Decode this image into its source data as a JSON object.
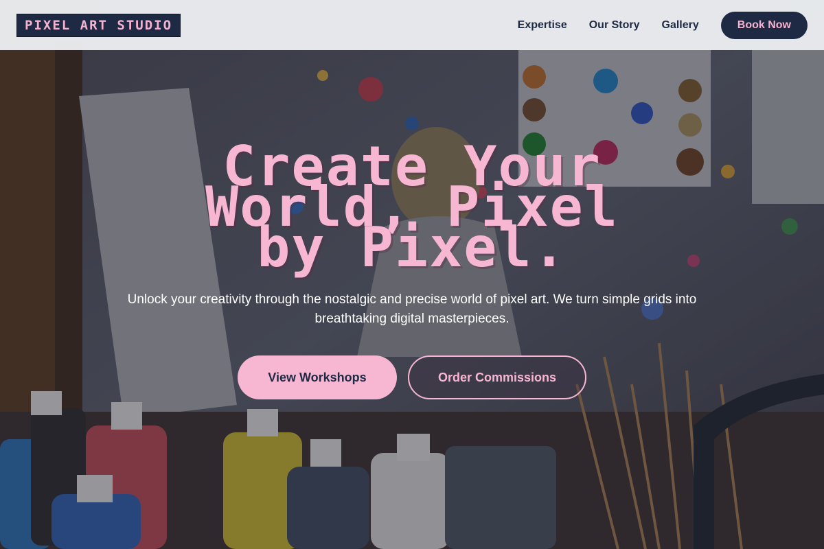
{
  "brand": {
    "logo_text": "PIXEL ART STUDIO"
  },
  "nav": {
    "links": [
      {
        "label": "Expertise"
      },
      {
        "label": "Our Story"
      },
      {
        "label": "Gallery"
      }
    ],
    "cta_label": "Book Now"
  },
  "hero": {
    "title_lines": [
      "Create Your",
      "World, Pixel",
      "by Pixel."
    ],
    "subtitle": "Unlock your creativity through the nostalgic and precise world of pixel art. We turn simple grids into breathtaking digital masterpieces.",
    "primary_cta": "View Workshops",
    "secondary_cta": "Order Commissions"
  },
  "colors": {
    "brand_navy": "#1e2a44",
    "accent_pink": "#f7b7d2",
    "header_bg": "#eceef0"
  }
}
